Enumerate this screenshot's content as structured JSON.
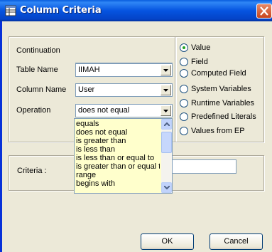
{
  "window": {
    "title": "Column Criteria"
  },
  "fields": {
    "continuation": {
      "label": "Continuation",
      "value": ""
    },
    "table_name": {
      "label": "Table Name",
      "value": "IIMAH"
    },
    "column_name": {
      "label": "Column Name",
      "value": "User"
    },
    "operation": {
      "label": "Operation",
      "value": "does not equal"
    }
  },
  "operation_options": [
    "equals",
    "does not equal",
    "is greater than",
    "is less than",
    "is less than or equal to",
    "is greater than or equal t",
    "range",
    "begins with"
  ],
  "source_options": [
    {
      "label": "Value",
      "selected": true
    },
    {
      "label": "Field",
      "selected": false
    },
    {
      "label": "Computed Field",
      "selected": false
    },
    {
      "label": "System Variables",
      "selected": false
    },
    {
      "label": "Runtime Variables",
      "selected": false
    },
    {
      "label": "Predefined Literals",
      "selected": false
    },
    {
      "label": "Values from EP",
      "selected": false
    }
  ],
  "criteria": {
    "label": "Criteria :",
    "value": ""
  },
  "buttons": {
    "ok": "OK",
    "cancel": "Cancel"
  },
  "colors": {
    "titlebar": "#0554e0",
    "dialog_bg": "#ece9d8",
    "disabled_field": "#fffbe8",
    "dropdown_bg": "#ffffcc"
  }
}
